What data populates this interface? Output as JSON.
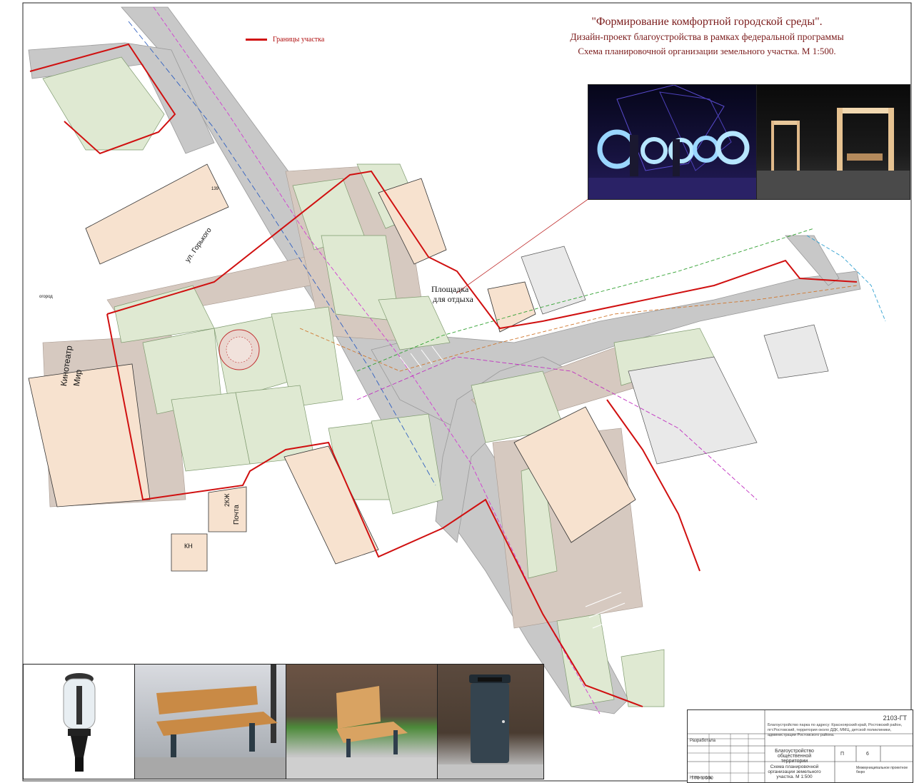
{
  "title": {
    "line1": "\"Формирование комфортной городской среды\".",
    "line2": "Дизайн-проект благоустройства в рамках федеральной программы",
    "line3": "Схема планировочной организации земельного участка. М 1:500."
  },
  "legend": {
    "label": "Границы участка",
    "color": "#d01010"
  },
  "labels": {
    "street_gorkogo": "ул. Горького",
    "rest_area_1": "Площадка",
    "rest_area_2": "для отдыха",
    "cinema_1": "Кинотеатр",
    "cinema_2": "Мир",
    "post_1": "2КЖ",
    "post_2": "Почта",
    "kn": "КН",
    "garden": "огород",
    "num_139": "139"
  },
  "stamp": {
    "code": "2103-ГТ",
    "description": "Благоустройство парка по адресу: Красноярский край, Ростовский район, пгт.Ростовский, территория около ДДК, ММЦ, детской поликлиники, администрации Ростовского района.",
    "name1": "Благоустройство общественной территории",
    "name2": "Схема планировочной организации земельного участка. М 1:500",
    "stage": "П",
    "sheet": "6",
    "developer": "Разработала",
    "control": "Н.контроль",
    "org": "Межмуниципальное проектное бюро"
  },
  "format": "770 x 660",
  "colors": {
    "road": "#c8c8c8",
    "path": "#d6c9c0",
    "lawn": "#dfe9d2",
    "building": "#f7e2cf",
    "boundary": "#d01010"
  }
}
